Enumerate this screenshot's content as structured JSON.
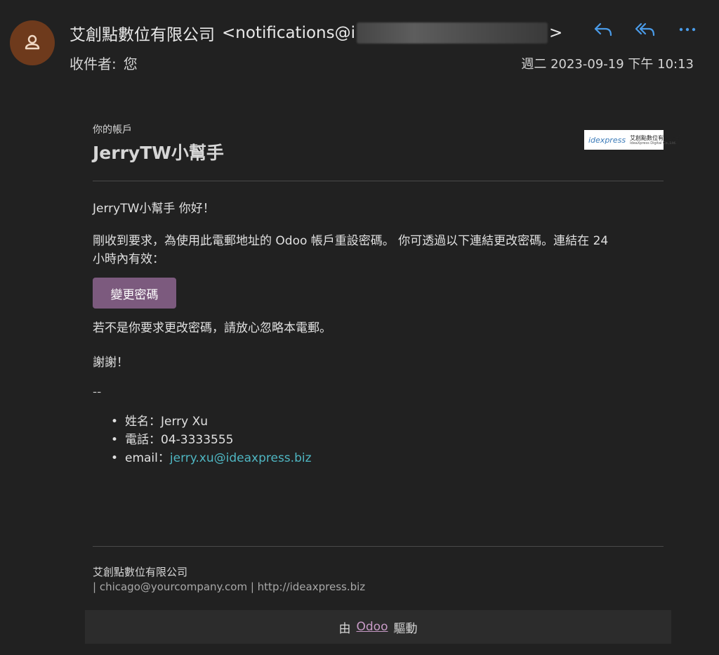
{
  "header": {
    "sender_name": "艾創點數位有限公司",
    "sender_email_prefix": "<notifications@i",
    "sender_email_suffix": ">",
    "to_label": "收件者:",
    "to_value": "您",
    "date": "週二 2023-09-19 下午 10:13",
    "avatar_icon": "person-icon",
    "actions": [
      "reply-icon",
      "reply-all-icon",
      "more-icon"
    ],
    "accent_color": "#4a9be8"
  },
  "email": {
    "account_label": "你的帳戶",
    "account_name": "JerryTW小幫手",
    "logo": {
      "mark": "idexpress",
      "text": "艾創點數位有限公司",
      "sub": "IdeaXpress Digital Co.,Ltd."
    },
    "greeting": "JerryTW小幫手 你好！",
    "paragraph_line1": "剛收到要求，為使用此電郵地址的 Odoo 帳戶重設密碼。 你可透過以下連結更改密碼。連結在 24",
    "paragraph_line2": "小時內有效：",
    "button_label": "變更密碼",
    "ignore_note": "若不是你要求更改密碼，請放心忽略本電郵。",
    "thanks": "謝謝！",
    "sig_sep": "--",
    "signature": {
      "name_label": "姓名：",
      "name_value": "Jerry Xu",
      "phone_label": "電話：",
      "phone_value": "04-3333555",
      "email_label": "email：",
      "email_value": "jerry.xu@ideaxpress.biz"
    },
    "footer_company": "艾創點數位有限公司",
    "footer_contact": "| chicago@yourcompany.com | http://ideaxpress.biz",
    "powered_prefix": "由",
    "powered_link": "Odoo",
    "powered_suffix": "驅動"
  }
}
